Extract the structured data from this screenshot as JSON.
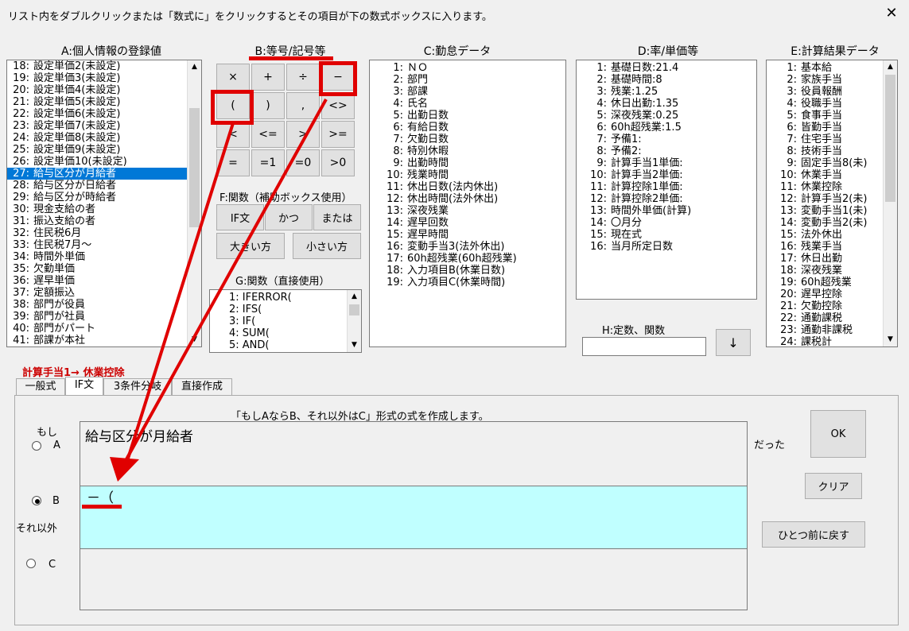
{
  "window": {
    "title": "リスト内をダブルクリックまたは「数式に」をクリックするとその項目が下の数式ボックスに入ります。",
    "close": "✕"
  },
  "sections": {
    "a": "A:個人情報の登録値",
    "b": "B:等号/記号等",
    "c": "C:勤怠データ",
    "d": "D:率/単価等",
    "e": "E:計算結果データ",
    "f": "F:関数（補助ボックス使用）",
    "g": "G:関数（直接使用）",
    "h": "H:定数、関数"
  },
  "list_a": [
    {
      "n": "18:",
      "t": "設定単価2(未設定)"
    },
    {
      "n": "19:",
      "t": "設定単価3(未設定)"
    },
    {
      "n": "20:",
      "t": "設定単価4(未設定)"
    },
    {
      "n": "21:",
      "t": "設定単価5(未設定)"
    },
    {
      "n": "22:",
      "t": "設定単価6(未設定)"
    },
    {
      "n": "23:",
      "t": "設定単価7(未設定)"
    },
    {
      "n": "24:",
      "t": "設定単価8(未設定)"
    },
    {
      "n": "25:",
      "t": "設定単価9(未設定)"
    },
    {
      "n": "26:",
      "t": "設定単価10(未設定)"
    },
    {
      "n": "27:",
      "t": "給与区分が月給者",
      "selected": true
    },
    {
      "n": "28:",
      "t": "給与区分が日給者"
    },
    {
      "n": "29:",
      "t": "給与区分が時給者"
    },
    {
      "n": "30:",
      "t": "現金支給の者"
    },
    {
      "n": "31:",
      "t": "振込支給の者"
    },
    {
      "n": "32:",
      "t": "住民税6月"
    },
    {
      "n": "33:",
      "t": "住民税7月～"
    },
    {
      "n": "34:",
      "t": "時間外単価"
    },
    {
      "n": "35:",
      "t": "欠勤単価"
    },
    {
      "n": "36:",
      "t": "遅早単価"
    },
    {
      "n": "37:",
      "t": "定額振込"
    },
    {
      "n": "38:",
      "t": "部門が役員"
    },
    {
      "n": "39:",
      "t": "部門が社員"
    },
    {
      "n": "40:",
      "t": "部門がパート"
    },
    {
      "n": "41:",
      "t": "部課が本社"
    }
  ],
  "keys": [
    "×",
    "+",
    "÷",
    "−",
    "(",
    ")",
    ",",
    "<>",
    "<",
    "<=",
    ">",
    ">=",
    "=",
    "=1",
    "=0",
    ">0"
  ],
  "f_buttons": [
    "IF文",
    "かつ",
    "または",
    "大きい方",
    "小さい方"
  ],
  "list_g": [
    "1: IFERROR(",
    "2: IFS(",
    "3: IF(",
    "4: SUM(",
    "5: AND("
  ],
  "list_c": [
    {
      "n": "1:",
      "t": "ＮＯ"
    },
    {
      "n": "2:",
      "t": "部門"
    },
    {
      "n": "3:",
      "t": "部課"
    },
    {
      "n": "4:",
      "t": "氏名"
    },
    {
      "n": "5:",
      "t": "出勤日数"
    },
    {
      "n": "6:",
      "t": "有給日数"
    },
    {
      "n": "7:",
      "t": "欠勤日数"
    },
    {
      "n": "8:",
      "t": "特別休暇"
    },
    {
      "n": "9:",
      "t": "出勤時間"
    },
    {
      "n": "10:",
      "t": "残業時間"
    },
    {
      "n": "11:",
      "t": "休出日数(法内休出)"
    },
    {
      "n": "12:",
      "t": "休出時間(法外休出)"
    },
    {
      "n": "13:",
      "t": "深夜残業"
    },
    {
      "n": "14:",
      "t": "遅早回数"
    },
    {
      "n": "15:",
      "t": "遅早時間"
    },
    {
      "n": "16:",
      "t": "変動手当3(法外休出)"
    },
    {
      "n": "17:",
      "t": "60h超残業(60h超残業)"
    },
    {
      "n": "18:",
      "t": "入力項目B(休業日数)"
    },
    {
      "n": "19:",
      "t": "入力項目C(休業時間)"
    }
  ],
  "list_d": [
    {
      "n": "1:",
      "t": "基礎日数:21.4"
    },
    {
      "n": "2:",
      "t": "基礎時間:8"
    },
    {
      "n": "3:",
      "t": "残業:1.25"
    },
    {
      "n": "4:",
      "t": "休日出勤:1.35"
    },
    {
      "n": "5:",
      "t": "深夜残業:0.25"
    },
    {
      "n": "6:",
      "t": "60h超残業:1.5"
    },
    {
      "n": "7:",
      "t": "予備1:"
    },
    {
      "n": "8:",
      "t": "予備2:"
    },
    {
      "n": "9:",
      "t": "計算手当1単価:"
    },
    {
      "n": "10:",
      "t": "計算手当2単価:"
    },
    {
      "n": "11:",
      "t": "計算控除1単価:"
    },
    {
      "n": "12:",
      "t": "計算控除2単価:"
    },
    {
      "n": "13:",
      "t": "時間外単価(計算)"
    },
    {
      "n": "14:",
      "t": "〇月分"
    },
    {
      "n": "15:",
      "t": "現在式"
    },
    {
      "n": "16:",
      "t": "当月所定日数"
    }
  ],
  "list_e": [
    {
      "n": "1:",
      "t": "基本給"
    },
    {
      "n": "2:",
      "t": "家族手当"
    },
    {
      "n": "3:",
      "t": "役員報酬"
    },
    {
      "n": "4:",
      "t": "役職手当"
    },
    {
      "n": "5:",
      "t": "食事手当"
    },
    {
      "n": "6:",
      "t": "皆勤手当"
    },
    {
      "n": "7:",
      "t": "住宅手当"
    },
    {
      "n": "8:",
      "t": "技術手当"
    },
    {
      "n": "9:",
      "t": "固定手当8(未)"
    },
    {
      "n": "10:",
      "t": "休業手当"
    },
    {
      "n": "11:",
      "t": "休業控除"
    },
    {
      "n": "12:",
      "t": "計算手当2(未)"
    },
    {
      "n": "13:",
      "t": "変動手当1(未)"
    },
    {
      "n": "14:",
      "t": "変動手当2(未)"
    },
    {
      "n": "15:",
      "t": "法外休出"
    },
    {
      "n": "16:",
      "t": "残業手当"
    },
    {
      "n": "17:",
      "t": "休日出勤"
    },
    {
      "n": "18:",
      "t": "深夜残業"
    },
    {
      "n": "19:",
      "t": "60h超残業"
    },
    {
      "n": "20:",
      "t": "遅早控除"
    },
    {
      "n": "21:",
      "t": "欠勤控除"
    },
    {
      "n": "22:",
      "t": "通勤課税"
    },
    {
      "n": "23:",
      "t": "通勤非課税"
    },
    {
      "n": "24:",
      "t": "課税計"
    }
  ],
  "h": {
    "input_value": "",
    "down_button": "↓"
  },
  "target_label": "計算手当1→ 休業控除",
  "tabs": [
    "一般式",
    "IF文",
    "3条件分岐",
    "直接作成"
  ],
  "active_tab": 1,
  "if_panel": {
    "description": "「もしAならB、それ以外はC」形式の式を作成します。",
    "label_moshi": "もし",
    "label_a": "A",
    "label_b": "B",
    "label_c": "C",
    "label_else": "それ以外",
    "label_datta": "だった",
    "value_a": "給与区分が月給者",
    "value_b": "－（",
    "value_c": "",
    "ok": "OK",
    "clear": "クリア",
    "undo": "ひとつ前に戻す"
  },
  "colors": {
    "accent_red": "#e00000",
    "selection": "#0078d7",
    "field_b_bg": "#c0ffff"
  }
}
